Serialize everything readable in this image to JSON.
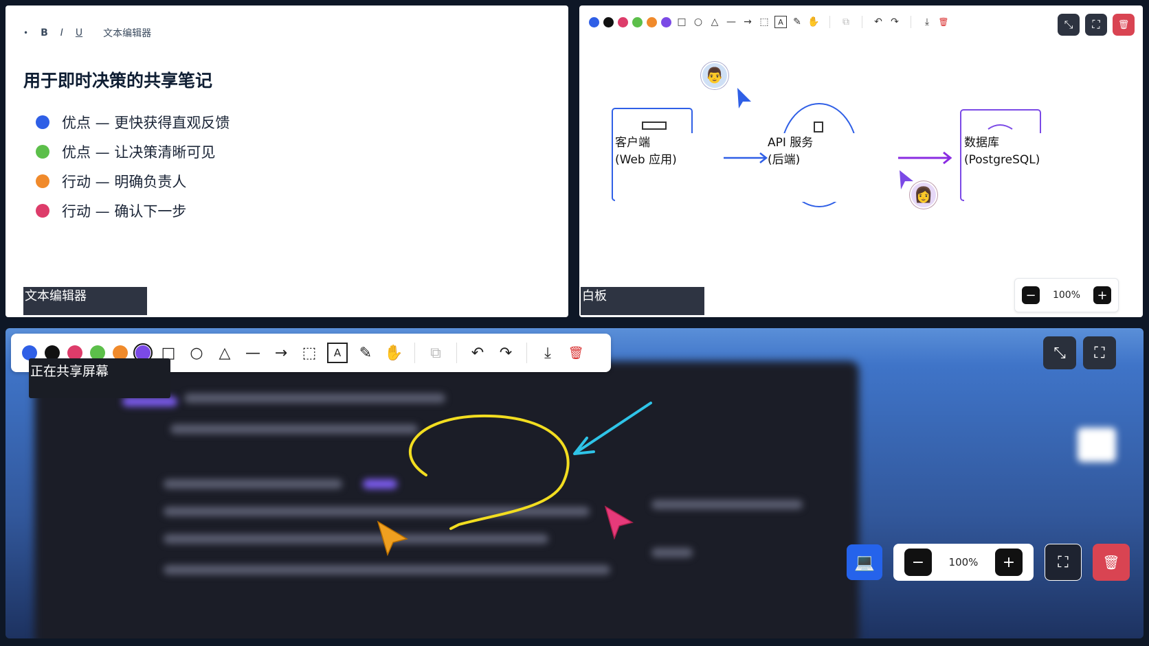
{
  "text_editor": {
    "toolbar": {
      "bullet": "•",
      "bold": "B",
      "italic": "I",
      "underline": "U",
      "label": "文本编辑器"
    },
    "title": "用于即时决策的共享笔记",
    "items": [
      {
        "color": "#2f5fe6",
        "text": "优点 — 更快获得直观反馈"
      },
      {
        "color": "#5cbf4a",
        "text": "优点 — 让决策清晰可见"
      },
      {
        "color": "#f08a2b",
        "text": "行动 — 明确负责人"
      },
      {
        "color": "#dd3c6a",
        "text": "行动 — 确认下一步"
      }
    ],
    "name_tag": "文本编辑器"
  },
  "whiteboard": {
    "colors": [
      "#2f5fe6",
      "#111111",
      "#dd3c6a",
      "#5cbf4a",
      "#f08a2b",
      "#7b4ae6"
    ],
    "nodes": [
      {
        "line1": "客户端",
        "line2": "(Web 应用)"
      },
      {
        "line1": "API 服务",
        "line2": "(后端)"
      },
      {
        "line1": "数据库",
        "line2": "(PostgreSQL)"
      }
    ],
    "zoom": {
      "minus": "−",
      "value": "100%",
      "plus": "+"
    },
    "name_tag": "白板"
  },
  "share": {
    "colors": [
      "#2f5fe6",
      "#111111",
      "#dd3c6a",
      "#5cbf4a",
      "#f08a2b",
      "#7b4ae6"
    ],
    "selected_color": "#7b4ae6",
    "label": "正在共享屏幕",
    "zoom": {
      "minus": "−",
      "value": "100%",
      "plus": "+"
    }
  },
  "icons": {
    "rect": "□",
    "circle": "○",
    "triangle": "△",
    "line": "—",
    "arrow": "→",
    "select": "⬚",
    "text": "A",
    "pencil": "✎",
    "hand": "✋",
    "copy": "⧉",
    "undo": "↶",
    "redo": "↷",
    "download": "⤓",
    "trash": "🗑",
    "collapse": "⤡",
    "expand": "⛶",
    "screen": "💻"
  }
}
